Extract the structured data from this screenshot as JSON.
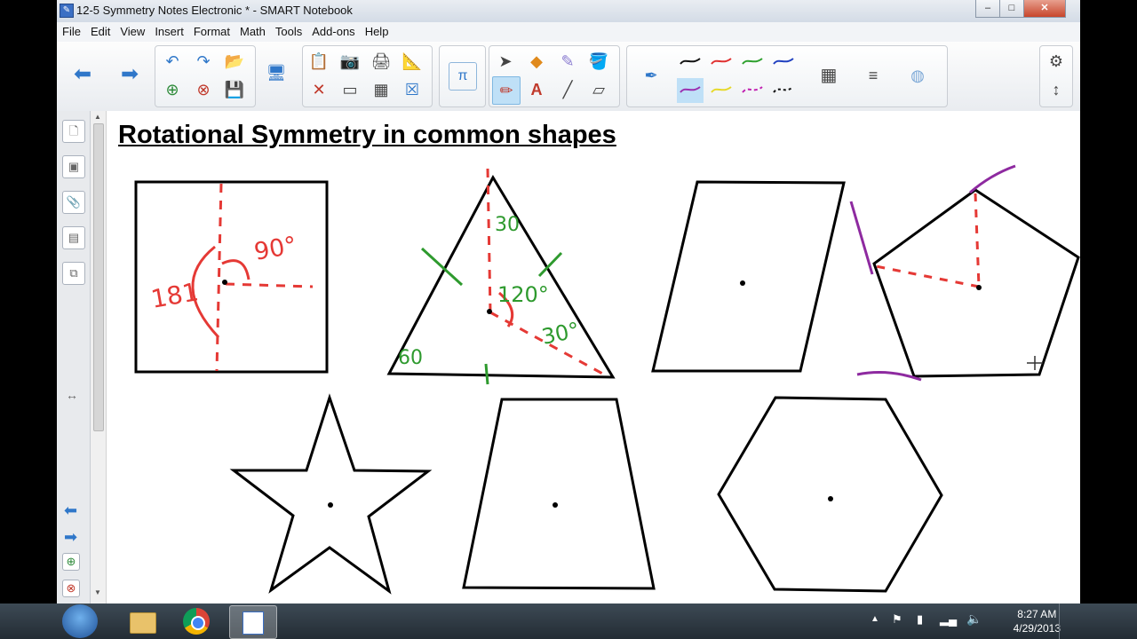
{
  "window": {
    "title": "12-5 Symmetry Notes Electronic * - SMART Notebook",
    "minimize": "–",
    "maximize": "□",
    "close": "✕"
  },
  "menu": [
    "File",
    "Edit",
    "View",
    "Insert",
    "Format",
    "Math",
    "Tools",
    "Add-ons",
    "Help"
  ],
  "toolbar": {
    "math_symbol": "π",
    "text_tool": "A"
  },
  "page": {
    "heading": "Rotational Symmetry in common shapes",
    "annotations": {
      "square_angle_a": "90°",
      "square_angle_b": "181",
      "triangle_top": "30",
      "triangle_center": "120°",
      "triangle_right": "30°",
      "triangle_left": "60"
    }
  },
  "leftbar": {
    "collapse_glyph": "↔",
    "prev_glyph": "⬅",
    "next_glyph": "➡"
  },
  "taskbar": {
    "time": "8:27 AM",
    "date": "4/29/2013"
  },
  "colors": {
    "annotation_red": "#e53935",
    "annotation_green": "#2e9a2e",
    "annotation_purple": "#8e2aa0",
    "shape_stroke": "#000000"
  }
}
